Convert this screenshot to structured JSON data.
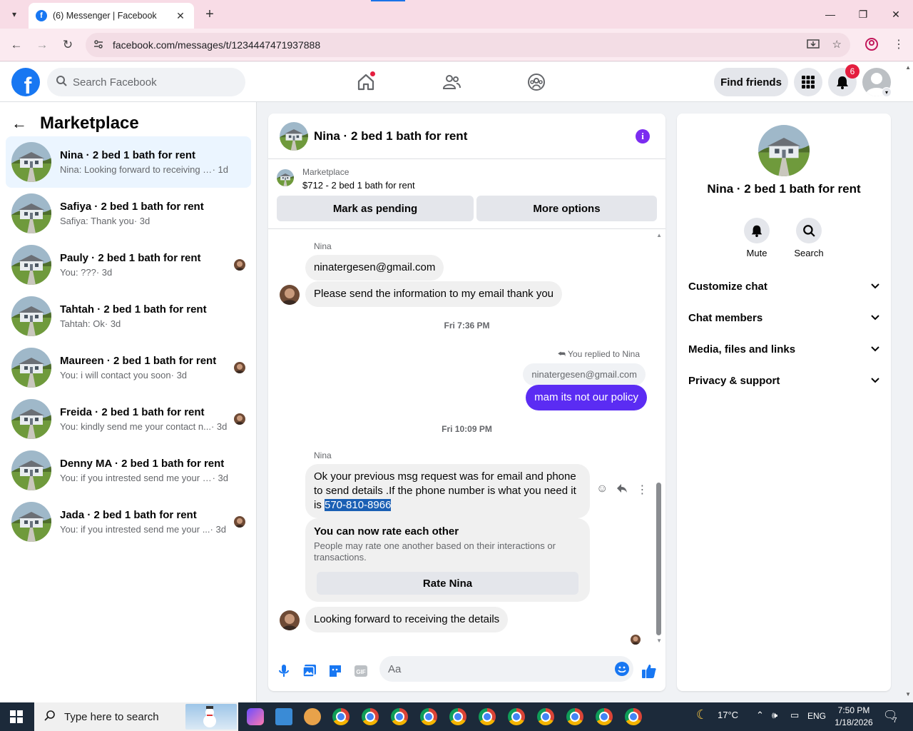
{
  "browser": {
    "tab_title": "(6) Messenger | Facebook",
    "favicon_letter": "f",
    "url": "facebook.com/messages/t/1234447471937888"
  },
  "header": {
    "logo_letter": "f",
    "search_placeholder": "Search Facebook",
    "find_friends": "Find friends",
    "notifications_count": "6"
  },
  "sidebar": {
    "title": "Marketplace",
    "conversations": [
      {
        "title": "Nina · 2 bed 1 bath for rent",
        "snippet": "Nina: Looking forward to receiving th...",
        "time": " · 1d",
        "read_avatar": false
      },
      {
        "title": "Safiya · 2 bed 1 bath for rent",
        "snippet": "Safiya: Thank you",
        "time": " · 3d",
        "read_avatar": false
      },
      {
        "title": "Pauly · 2 bed 1 bath for rent",
        "snippet": "You: ???",
        "time": " · 3d",
        "read_avatar": true
      },
      {
        "title": "Tahtah · 2 bed 1 bath for rent",
        "snippet": "Tahtah: Ok",
        "time": " · 3d",
        "read_avatar": false
      },
      {
        "title": "Maureen · 2 bed 1 bath for rent",
        "snippet": "You: i will contact you soon",
        "time": " · 3d",
        "read_avatar": true
      },
      {
        "title": "Freida · 2 bed 1 bath for rent",
        "snippet": "You: kindly send me your contact n...",
        "time": " · 3d",
        "read_avatar": true
      },
      {
        "title": "Denny MA · 2 bed 1 bath for rent",
        "snippet": "You: if you intrested send me your co...",
        "time": " · 3d",
        "read_avatar": false
      },
      {
        "title": "Jada · 2 bed 1 bath for rent",
        "snippet": "You: if you intrested send me your ...",
        "time": " · 3d",
        "read_avatar": true
      }
    ]
  },
  "chat": {
    "title": "Nina · 2 bed 1 bath for rent",
    "listing_source": "Marketplace",
    "listing_price": "$712 - 2 bed 1 bath for rent",
    "mark_pending": "Mark as pending",
    "more_options": "More options",
    "sender": "Nina",
    "msg1": "ninatergesen@gmail.com",
    "msg2": "Please send the information to my email thank you",
    "time1": "Fri 7:36 PM",
    "replied_label": "You replied to Nina",
    "quoted": "ninatergesen@gmail.com",
    "my_msg": "mam its not our policy",
    "time2": "Fri 10:09 PM",
    "msg3_pre": "Ok your previous msg request was for email and phone to send details .If the phone number is what you need it is ",
    "msg3_phone": "570-810-8966",
    "rate_title": "You can now rate each other",
    "rate_desc": "People may rate one another based on their interactions or transactions.",
    "rate_button": "Rate Nina",
    "msg4": "Looking forward to receiving the details",
    "composer_placeholder": "Aa"
  },
  "right_panel": {
    "title": "Nina · 2 bed 1 bath for rent",
    "mute": "Mute",
    "search": "Search",
    "sections": [
      "Customize chat",
      "Chat members",
      "Media, files and links",
      "Privacy & support"
    ]
  },
  "taskbar": {
    "search_placeholder": "Type here to search",
    "temperature": "17°C",
    "language": "ENG",
    "time": "7:50 PM",
    "date": "1/18/2026",
    "notification_count": "7"
  },
  "colors": {
    "fb_blue": "#1877f2",
    "my_bubble": "#5b2cf3",
    "badge_red": "#e41e3f"
  }
}
